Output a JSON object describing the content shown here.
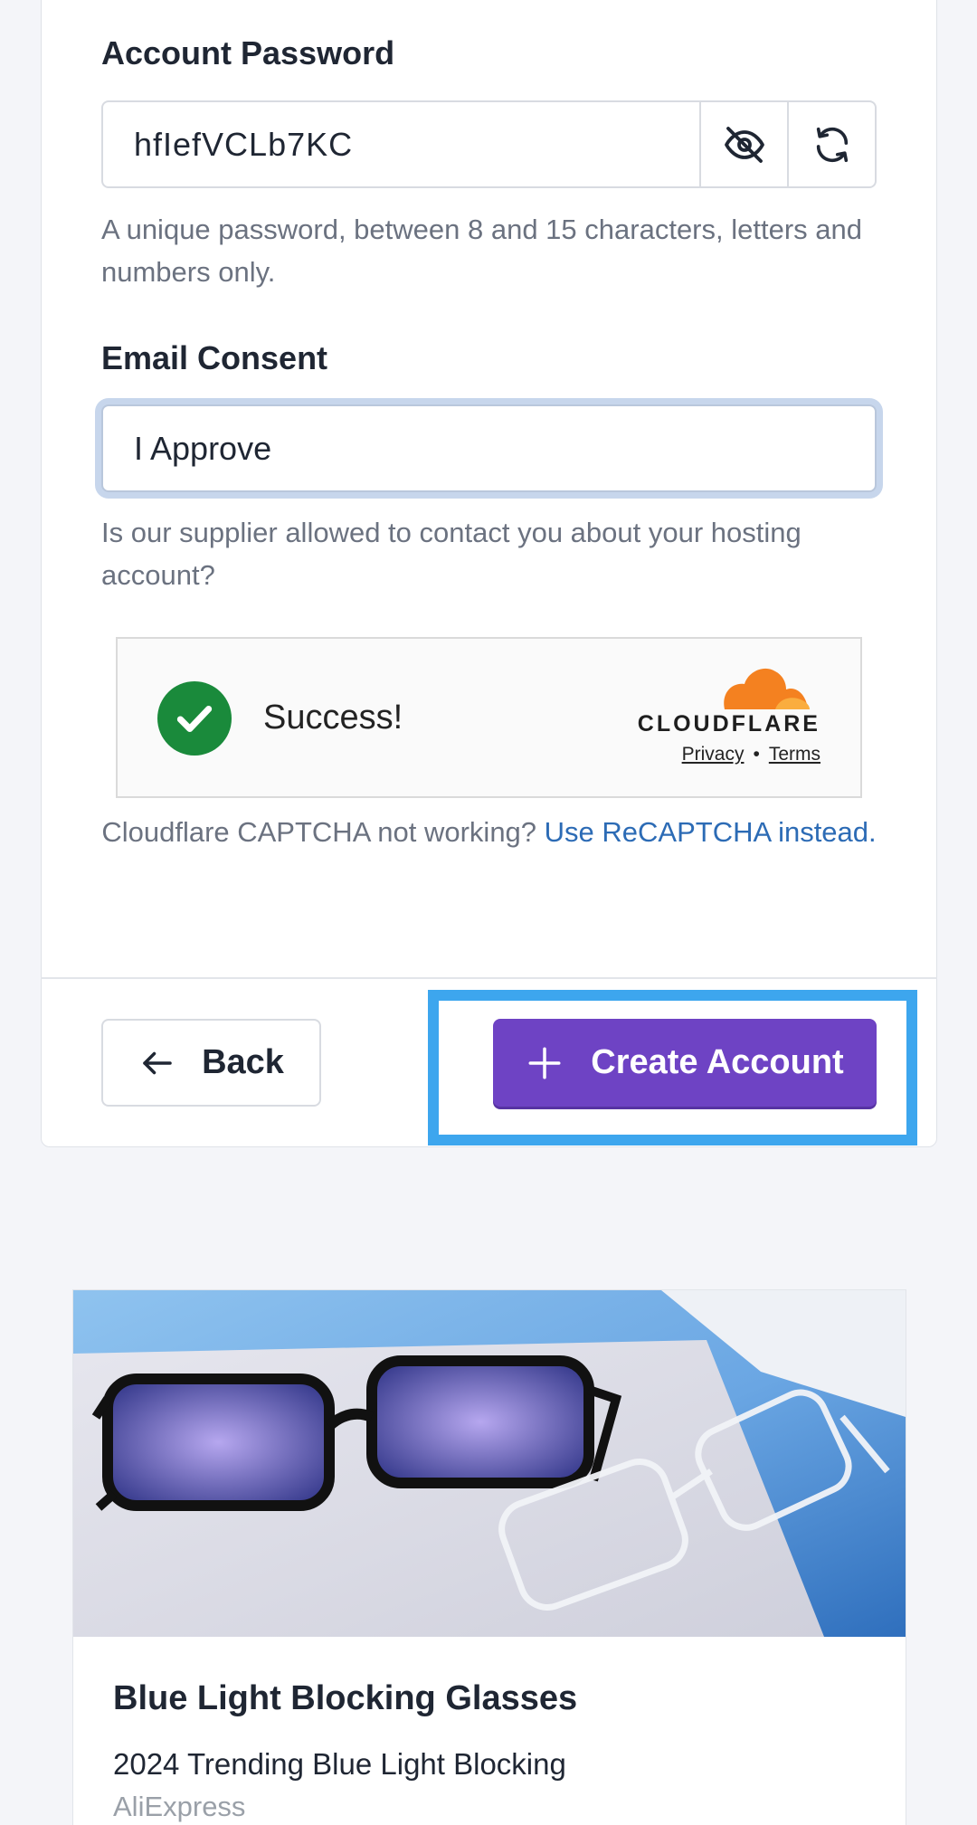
{
  "form": {
    "password_label": "Account Password",
    "password_value": "hfIefVCLb7KC",
    "password_help": "A unique password, between 8 and 15 characters, letters and numbers only.",
    "toggle_visibility_icon": "eye-off-icon",
    "regenerate_icon": "refresh-icon",
    "consent_label": "Email Consent",
    "consent_value": "I Approve",
    "consent_help": "Is our supplier allowed to contact you about your hosting account?"
  },
  "captcha": {
    "status": "Success!",
    "brand": "CLOUDFLARE",
    "privacy": "Privacy",
    "separator": "•",
    "terms": "Terms",
    "fallback_text": "Cloudflare CAPTCHA not working?",
    "fallback_link": "Use ReCAPTCHA instead."
  },
  "actions": {
    "back_label": "Back",
    "create_label": "Create Account"
  },
  "ad": {
    "title": "Blue Light Blocking Glasses",
    "description": "2024 Trending Blue Light Blocking",
    "source": "AliExpress"
  },
  "colors": {
    "primary": "#6e43c4",
    "highlight": "#3da6ee",
    "success": "#1a8a3b",
    "link": "#2c6bb5",
    "cloudflare_orange": "#f48120"
  }
}
